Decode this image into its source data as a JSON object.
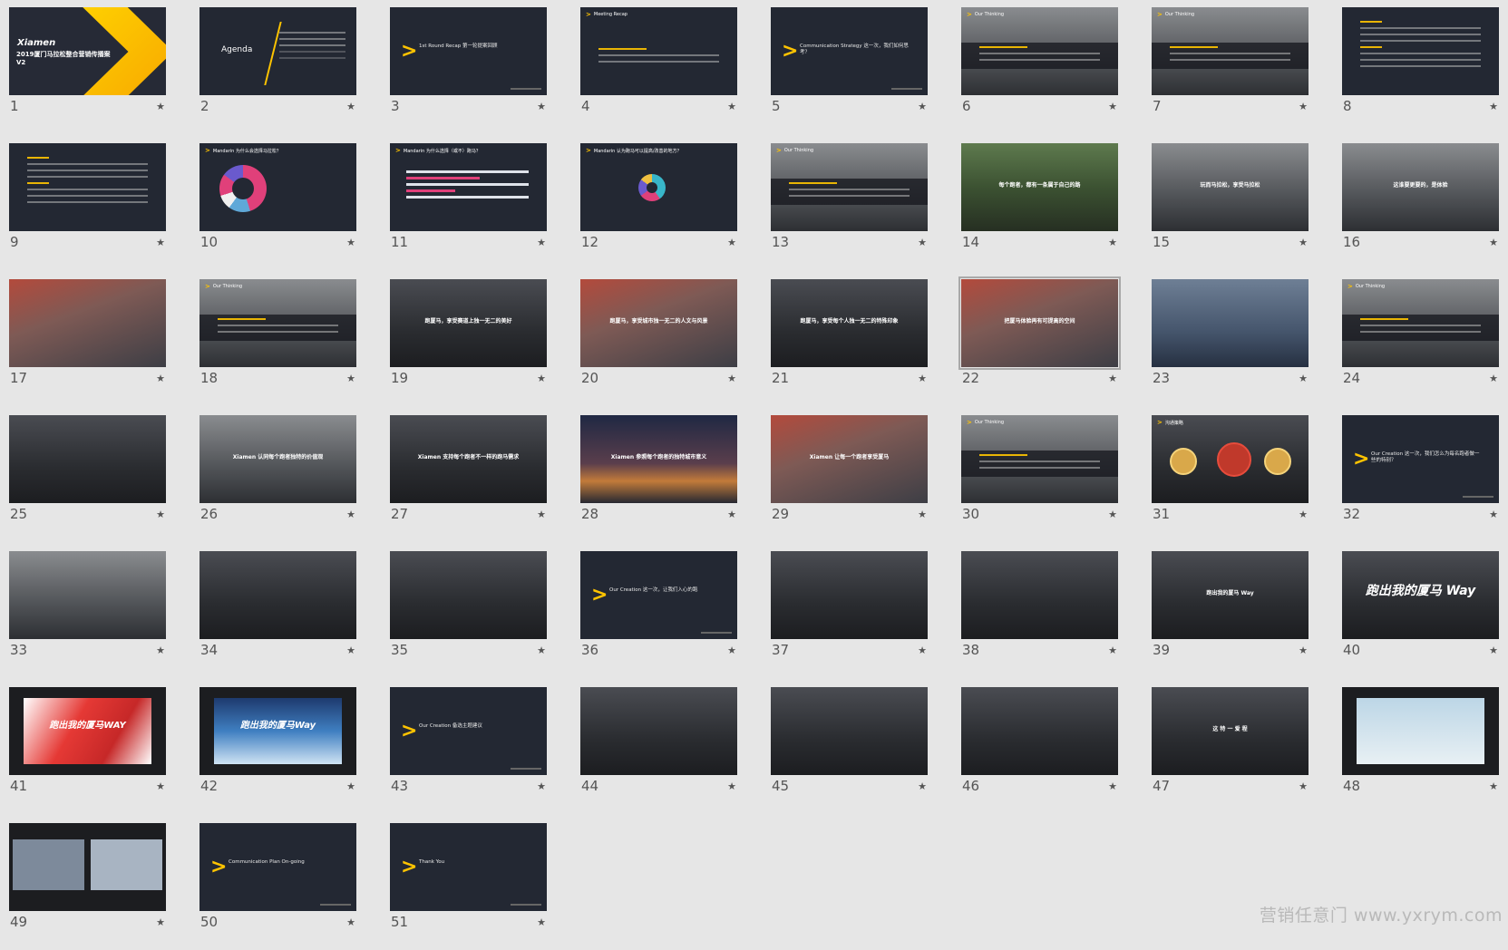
{
  "watermark": "营销任意门 www.yxrym.com",
  "slides": [
    {
      "num": "1",
      "type": "title",
      "text": "2019厦门马拉松整合营销传播案V2",
      "logo": "Xiamen"
    },
    {
      "num": "2",
      "type": "agenda",
      "text": "Agenda"
    },
    {
      "num": "3",
      "type": "section",
      "text": "1st Round Recap 第一轮提案回顾"
    },
    {
      "num": "4",
      "type": "recap",
      "text": "Meeting Recap"
    },
    {
      "num": "5",
      "type": "section",
      "text": "Communication Strategy 这一次，我们如何思考？"
    },
    {
      "num": "6",
      "type": "thinking",
      "text": "Our Thinking"
    },
    {
      "num": "7",
      "type": "thinking",
      "text": "Our Thinking"
    },
    {
      "num": "8",
      "type": "text",
      "text": ""
    },
    {
      "num": "9",
      "type": "text",
      "text": ""
    },
    {
      "num": "10",
      "type": "donut",
      "text": "Mandarin 为什么会选择马拉松？"
    },
    {
      "num": "11",
      "type": "bars",
      "text": "Mandarin 为什么选择（或不）跑马？"
    },
    {
      "num": "12",
      "type": "ring",
      "text": "Mandarin 认为跑马可以提高/改善的地方？"
    },
    {
      "num": "13",
      "type": "thinking",
      "text": "Our Thinking"
    },
    {
      "num": "14",
      "type": "green",
      "text": "每个跑者，都有一条属于自己的路"
    },
    {
      "num": "15",
      "type": "gray",
      "text": "玩而马拉松，享受马拉松"
    },
    {
      "num": "16",
      "type": "gray",
      "text": "这谁要更要的，是体验"
    },
    {
      "num": "17",
      "type": "crowd",
      "text": ""
    },
    {
      "num": "18",
      "type": "thinking",
      "text": "Our Thinking"
    },
    {
      "num": "19",
      "type": "dark",
      "text": "跑厦马，享受赛道上独一无二的美好"
    },
    {
      "num": "20",
      "type": "crowd",
      "text": "跑厦马，享受城市独一无二的人文与风景"
    },
    {
      "num": "21",
      "type": "dark",
      "text": "跑厦马，享受每个人独一无二的特殊印象"
    },
    {
      "num": "22",
      "type": "crowd",
      "text": "把厦马体验再有可提高的空间",
      "selected": true
    },
    {
      "num": "23",
      "type": "city",
      "text": ""
    },
    {
      "num": "24",
      "type": "thinking",
      "text": "Our Thinking"
    },
    {
      "num": "25",
      "type": "dark",
      "text": ""
    },
    {
      "num": "26",
      "type": "gray",
      "text": "Xiamen 认同每个跑者独特的价值观"
    },
    {
      "num": "27",
      "type": "dark",
      "text": "Xiamen 支持每个跑者不一样的跑马需求"
    },
    {
      "num": "28",
      "type": "sunset",
      "text": "Xiamen 参照每个跑者的独特城市意义"
    },
    {
      "num": "29",
      "type": "crowd",
      "text": "Xiamen 让每一个跑者享受厦马"
    },
    {
      "num": "30",
      "type": "thinking",
      "text": "Our Thinking"
    },
    {
      "num": "31",
      "type": "circles",
      "text": "沟通策略"
    },
    {
      "num": "32",
      "type": "section",
      "text": "Our Creation 这一次，我们怎么为每名跑者做一些的特别？"
    },
    {
      "num": "33",
      "type": "gray",
      "text": ""
    },
    {
      "num": "34",
      "type": "dark",
      "text": ""
    },
    {
      "num": "35",
      "type": "dark",
      "text": ""
    },
    {
      "num": "36",
      "type": "section",
      "text": "Our Creation 这一次，让我们入心的跑"
    },
    {
      "num": "37",
      "type": "dark",
      "text": ""
    },
    {
      "num": "38",
      "type": "dark",
      "text": ""
    },
    {
      "num": "39",
      "type": "dark",
      "text": "跑出我的厦马 Way"
    },
    {
      "num": "40",
      "type": "big",
      "text": "跑出我的厦马 Way"
    },
    {
      "num": "41",
      "type": "red",
      "text": "跑出我的厦马WAY"
    },
    {
      "num": "42",
      "type": "blue",
      "text": "跑出我的厦马Way"
    },
    {
      "num": "43",
      "type": "section",
      "text": "Our Creation 备选主题建议"
    },
    {
      "num": "44",
      "type": "dark",
      "text": ""
    },
    {
      "num": "45",
      "type": "dark",
      "text": ""
    },
    {
      "num": "46",
      "type": "dark",
      "text": ""
    },
    {
      "num": "47",
      "type": "dark",
      "text": "这 特 一 爱 程"
    },
    {
      "num": "48",
      "type": "sky",
      "text": ""
    },
    {
      "num": "49",
      "type": "photos",
      "text": ""
    },
    {
      "num": "50",
      "type": "section",
      "text": "Communication Plan On-going"
    },
    {
      "num": "51",
      "type": "section",
      "text": "Thank You"
    }
  ],
  "star_icon": "★",
  "colors": {
    "accent": "#ffc400",
    "slide_bg": "#232833",
    "canvas_bg": "#e6e6e6"
  }
}
